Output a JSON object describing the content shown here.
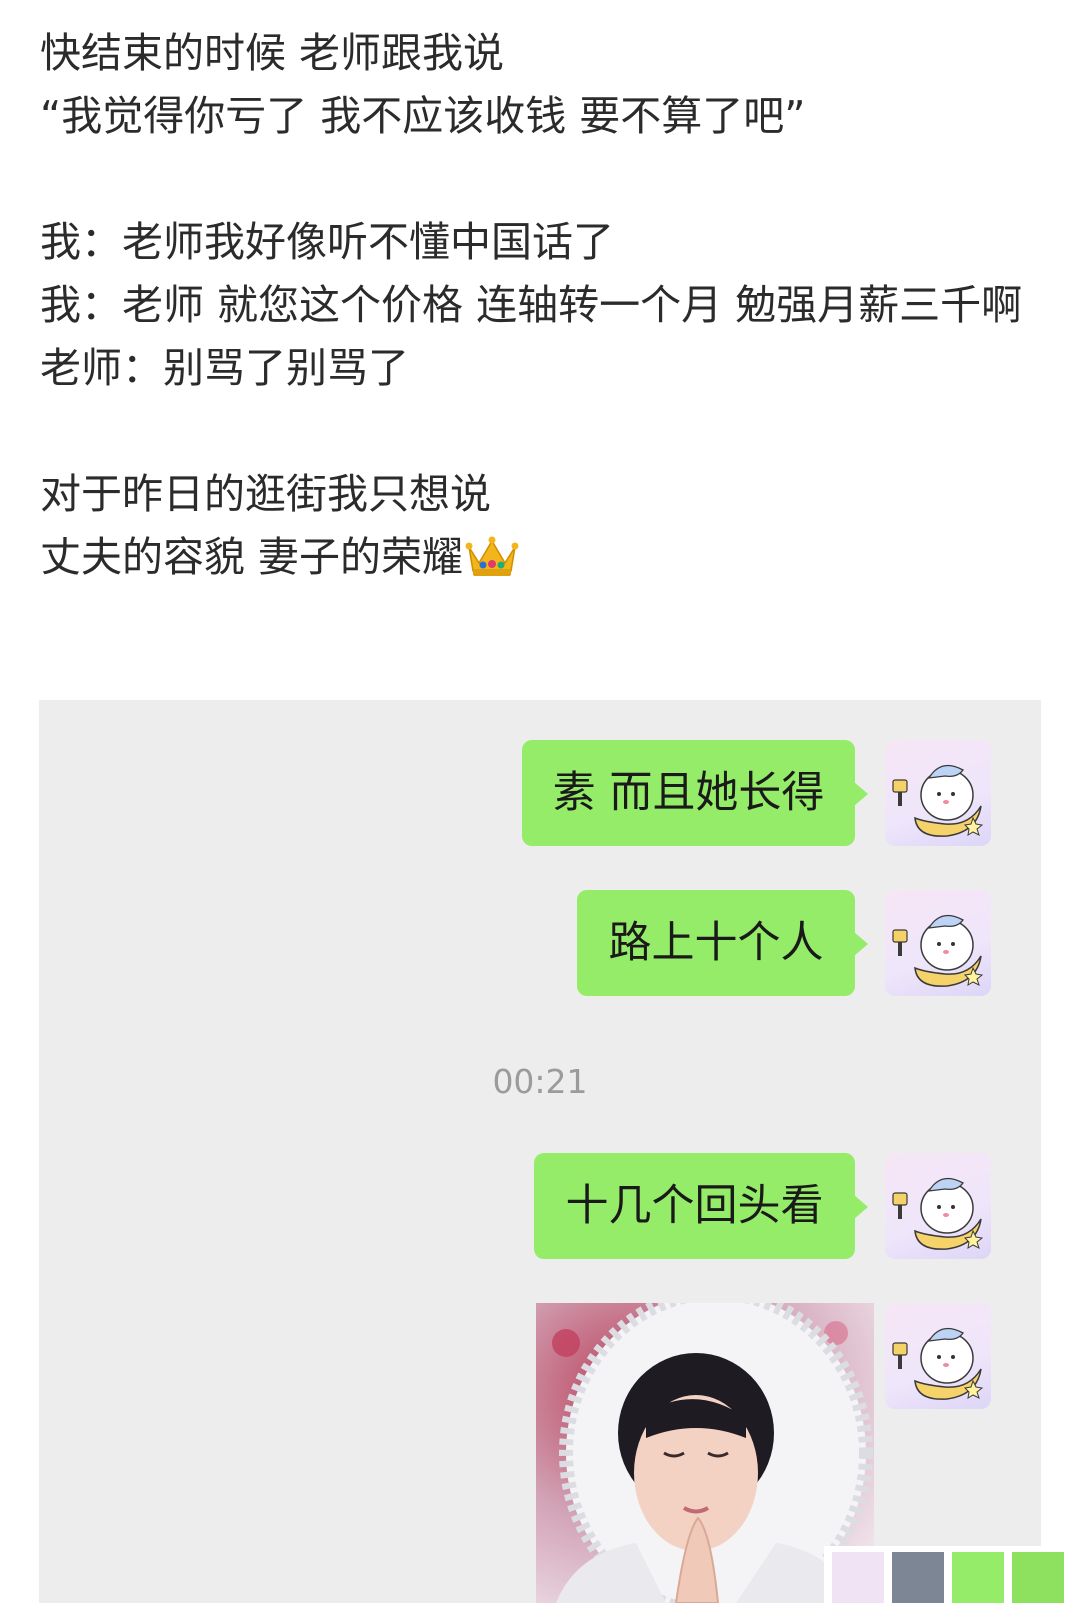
{
  "post": {
    "lines": [
      "快结束的时候 老师跟我说",
      "“我觉得你亏了 我不应该收钱 要不算了吧”",
      "",
      "我：老师我好像听不懂中国话了",
      "我：老师 就您这个价格 连轴转一个月 勉强月薪三千啊",
      "老师：别骂了别骂了",
      "",
      "对于昨日的逛街我只想说",
      "丈夫的容貌 妻子的荣耀"
    ],
    "crown_emoji": "crown-emoji"
  },
  "chat": {
    "messages": [
      {
        "text": "素 而且她长得"
      },
      {
        "text": "路上十个人"
      },
      {
        "text": "十几个回头看"
      }
    ],
    "timestamp": "00:21",
    "bubble_color": "#95ec69",
    "background_color": "#ededed"
  },
  "palette": [
    "#f0e3f3",
    "#7d8695",
    "#95ec69",
    "#8ee05f",
    "#a3ea7c"
  ]
}
